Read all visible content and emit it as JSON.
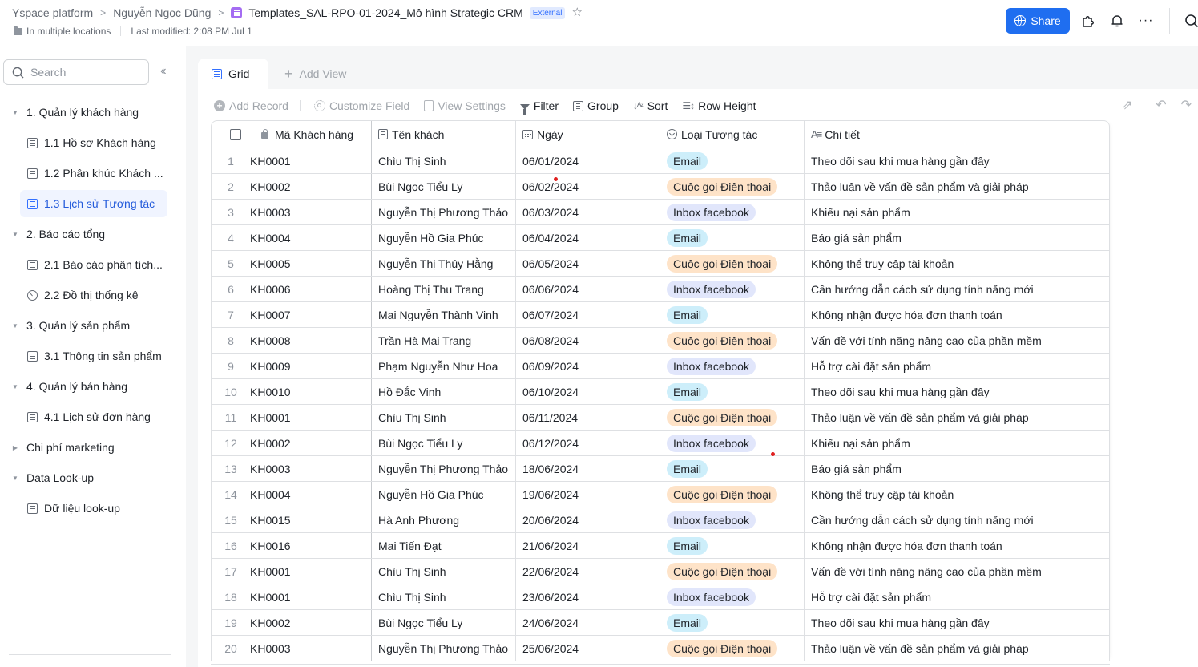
{
  "header": {
    "breadcrumbs": [
      "Yspace platform",
      "Nguyễn Ngọc Dũng"
    ],
    "doc_title": "Templates_SAL-RPO-01-2024_Mô hình Strategic CRM",
    "external_badge": "External",
    "location": "In multiple locations",
    "last_modified": "Last modified: 2:08 PM Jul 1",
    "share_label": "Share",
    "icons": [
      "globe-icon",
      "star-icon",
      "puzzle-icon",
      "bell-icon",
      "more-icon",
      "search-icon"
    ]
  },
  "sidebar": {
    "search_placeholder": "Search",
    "items": [
      {
        "type": "group",
        "label": "1. Quản lý khách hàng",
        "expanded": true
      },
      {
        "type": "child",
        "icon": "grid",
        "label": "1.1 Hồ sơ Khách hàng"
      },
      {
        "type": "child",
        "icon": "grid",
        "label": "1.2 Phân khúc Khách ..."
      },
      {
        "type": "child",
        "icon": "grid",
        "label": "1.3 Lịch sử Tương tác",
        "active": true
      },
      {
        "type": "group",
        "label": "2. Báo cáo tổng",
        "expanded": true
      },
      {
        "type": "child",
        "icon": "grid",
        "label": "2.1 Báo cáo phân tích..."
      },
      {
        "type": "child",
        "icon": "dashboard",
        "label": "2.2 Đồ thị thống kê"
      },
      {
        "type": "group",
        "label": "3. Quản lý sản phẩm",
        "expanded": true
      },
      {
        "type": "child",
        "icon": "grid",
        "label": "3.1 Thông tin sản phẩm"
      },
      {
        "type": "group",
        "label": "4. Quản lý bán hàng",
        "expanded": true
      },
      {
        "type": "child",
        "icon": "grid",
        "label": "4.1 Lịch sử đơn hàng"
      },
      {
        "type": "group",
        "label": "Chi phí marketing",
        "expanded": false
      },
      {
        "type": "group",
        "label": "Data Look-up",
        "expanded": true
      },
      {
        "type": "child",
        "icon": "grid",
        "label": "Dữ liệu look-up"
      }
    ]
  },
  "views": {
    "tabs": [
      {
        "label": "Grid",
        "active": true
      }
    ],
    "add_view_label": "Add View"
  },
  "toolbar": {
    "add_record": "Add Record",
    "customize_field": "Customize Field",
    "view_settings": "View Settings",
    "filter": "Filter",
    "group": "Group",
    "sort": "Sort",
    "row_height": "Row Height"
  },
  "table": {
    "columns": [
      "Mã Khách hàng",
      "Tên khách",
      "Ngày",
      "Loại Tương tác",
      "Chi tiết"
    ],
    "type_colors": {
      "Email": "#cdeefa",
      "Cuộc gọi Điện thoại": "#fee3c8",
      "Inbox facebook": "#e1e6fb"
    },
    "rows": [
      {
        "n": "1",
        "code": "KH0001",
        "name": "Chìu Thị Sinh",
        "date": "06/01/2024",
        "type": "Email",
        "detail": "Theo dõi sau khi mua hàng gần đây"
      },
      {
        "n": "2",
        "code": "KH0002",
        "name": "Bùi Ngọc Tiểu Ly",
        "date": "06/02/2024",
        "type": "Cuộc gọi Điện thoại",
        "detail": "Thảo luận về vấn đề sản phẩm và giải pháp"
      },
      {
        "n": "3",
        "code": "KH0003",
        "name": "Nguyễn Thị Phương Thảo",
        "date": "06/03/2024",
        "type": "Inbox facebook",
        "detail": "Khiếu nại sản phẩm"
      },
      {
        "n": "4",
        "code": "KH0004",
        "name": "Nguyễn Hồ Gia Phúc",
        "date": "06/04/2024",
        "type": "Email",
        "detail": "Báo giá sản phẩm"
      },
      {
        "n": "5",
        "code": "KH0005",
        "name": "Nguyễn Thị Thúy Hằng",
        "date": "06/05/2024",
        "type": "Cuộc gọi Điện thoại",
        "detail": "Không thể truy cập tài khoản"
      },
      {
        "n": "6",
        "code": "KH0006",
        "name": "Hoàng Thị Thu Trang",
        "date": "06/06/2024",
        "type": "Inbox facebook",
        "detail": "Cần hướng dẫn cách sử dụng tính năng mới"
      },
      {
        "n": "7",
        "code": "KH0007",
        "name": "Mai Nguyễn Thành Vinh",
        "date": "06/07/2024",
        "type": "Email",
        "detail": "Không nhận được hóa đơn thanh toán"
      },
      {
        "n": "8",
        "code": "KH0008",
        "name": "Trần Hà Mai Trang",
        "date": "06/08/2024",
        "type": "Cuộc gọi Điện thoại",
        "detail": "Vấn đề với tính năng nâng cao của phần mềm"
      },
      {
        "n": "9",
        "code": "KH0009",
        "name": "Phạm Nguyễn Như Hoa",
        "date": "06/09/2024",
        "type": "Inbox facebook",
        "detail": "Hỗ trợ cài đặt sản phẩm"
      },
      {
        "n": "10",
        "code": "KH0010",
        "name": "Hồ Đắc Vinh",
        "date": "06/10/2024",
        "type": "Email",
        "detail": "Theo dõi sau khi mua hàng gần đây"
      },
      {
        "n": "11",
        "code": "KH0001",
        "name": "Chìu Thị Sinh",
        "date": "06/11/2024",
        "type": "Cuộc gọi Điện thoại",
        "detail": "Thảo luận về vấn đề sản phẩm và giải pháp"
      },
      {
        "n": "12",
        "code": "KH0002",
        "name": "Bùi Ngọc Tiểu Ly",
        "date": "06/12/2024",
        "type": "Inbox facebook",
        "detail": "Khiếu nại sản phẩm"
      },
      {
        "n": "13",
        "code": "KH0003",
        "name": "Nguyễn Thị Phương Thảo",
        "date": "18/06/2024",
        "type": "Email",
        "detail": "Báo giá sản phẩm"
      },
      {
        "n": "14",
        "code": "KH0004",
        "name": "Nguyễn Hồ Gia Phúc",
        "date": "19/06/2024",
        "type": "Cuộc gọi Điện thoại",
        "detail": "Không thể truy cập tài khoản"
      },
      {
        "n": "15",
        "code": "KH0015",
        "name": "Hà Anh Phương",
        "date": "20/06/2024",
        "type": "Inbox facebook",
        "detail": "Cần hướng dẫn cách sử dụng tính năng mới"
      },
      {
        "n": "16",
        "code": "KH0016",
        "name": "Mai Tiến Đạt",
        "date": "21/06/2024",
        "type": "Email",
        "detail": "Không nhận được hóa đơn thanh toán"
      },
      {
        "n": "17",
        "code": "KH0001",
        "name": "Chìu Thị Sinh",
        "date": "22/06/2024",
        "type": "Cuộc gọi Điện thoại",
        "detail": "Vấn đề với tính năng nâng cao của phần mềm"
      },
      {
        "n": "18",
        "code": "KH0001",
        "name": "Chìu Thị Sinh",
        "date": "23/06/2024",
        "type": "Inbox facebook",
        "detail": "Hỗ trợ cài đặt sản phẩm"
      },
      {
        "n": "19",
        "code": "KH0002",
        "name": "Bùi Ngọc Tiểu Ly",
        "date": "24/06/2024",
        "type": "Email",
        "detail": "Theo dõi sau khi mua hàng gần đây"
      },
      {
        "n": "20",
        "code": "KH0003",
        "name": "Nguyễn Thị Phương Thảo",
        "date": "25/06/2024",
        "type": "Cuộc gọi Điện thoại",
        "detail": "Thảo luận về vấn đề sản phẩm và giải pháp"
      }
    ]
  }
}
